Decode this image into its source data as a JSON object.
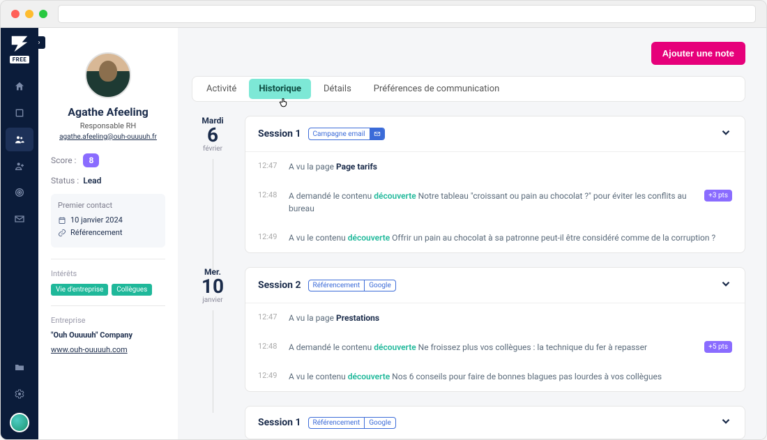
{
  "sidebar": {
    "badge": "FREE"
  },
  "profile": {
    "name": "Agathe Afeeling",
    "title": "Responsable RH",
    "email": "agathe.afeeling@ouh-ouuuuh.fr",
    "score_label": "Score :",
    "score_value": "8",
    "status_label": "Status :",
    "status_value": "Lead",
    "first_contact": {
      "title": "Premier contact",
      "date": "10 janvier 2024",
      "source": "Référencement"
    },
    "interests": {
      "title": "Intérêts",
      "tags": [
        "Vie d'entreprise",
        "Collègues"
      ]
    },
    "company": {
      "title": "Entreprise",
      "name": "\"Ouh Ouuuuh\" Company",
      "url": "www.ouh-ouuuuh.com"
    }
  },
  "toolbar": {
    "add_note": "Ajouter une note"
  },
  "tabs": [
    "Activité",
    "Historique",
    "Détails",
    "Préférences de communication"
  ],
  "timeline": [
    {
      "date": {
        "dayname": "Mardi",
        "number": "6",
        "month": "février"
      },
      "session": {
        "title": "Session 1",
        "chip_primary": "Campagne email",
        "chip_has_icon": true,
        "events": [
          {
            "time": "12:47",
            "prefix": "A vu la page ",
            "green": "",
            "strong": "Page tarifs",
            "suffix": "",
            "badge": ""
          },
          {
            "time": "12:48",
            "prefix": "A demandé le contenu ",
            "green": "découverte",
            "strong": "",
            "suffix": " Notre tableau \"croissant ou pain au chocolat ?\" pour éviter les conflits au bureau",
            "badge": "+3 pts"
          },
          {
            "time": "12:49",
            "prefix": "A vu le contenu ",
            "green": "découverte",
            "strong": "",
            "suffix": " Offrir un pain au chocolat à sa patronne peut-il être considéré comme de la corruption ?",
            "badge": ""
          }
        ]
      }
    },
    {
      "date": {
        "dayname": "Mer.",
        "number": "10",
        "month": "janvier"
      },
      "session": {
        "title": "Session 2",
        "chip_primary": "Référencement",
        "chip_secondary": "Google",
        "events": [
          {
            "time": "12:47",
            "prefix": "A vu la page ",
            "green": "",
            "strong": "Prestations",
            "suffix": "",
            "badge": ""
          },
          {
            "time": "12:48",
            "prefix": "A demandé le contenu ",
            "green": "découverte",
            "strong": "",
            "suffix": " Ne froissez plus vos collègues : la technique du fer à repasser",
            "badge": "+5 pts"
          },
          {
            "time": "12:49",
            "prefix": "A vu le contenu ",
            "green": "découverte",
            "strong": "",
            "suffix": " Nos 6 conseils pour faire de bonnes blagues pas lourdes à vos collègues",
            "badge": ""
          }
        ]
      }
    }
  ],
  "bottom_session": {
    "title": "Session 1",
    "chip_primary": "Référencement",
    "chip_secondary": "Google"
  }
}
